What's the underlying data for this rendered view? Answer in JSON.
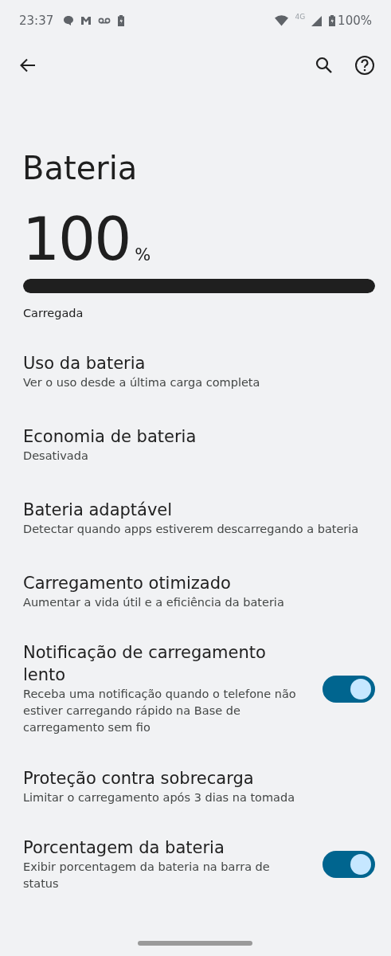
{
  "status_bar": {
    "time": "23:37",
    "network": "4G",
    "battery": "100%"
  },
  "title": "Bateria",
  "battery": {
    "percent": "100",
    "unit": "%",
    "level": 1.0,
    "state": "Carregada"
  },
  "items": [
    {
      "kind": "link",
      "title": "Uso da bateria",
      "summary": "Ver o uso desde a última carga completa"
    },
    {
      "kind": "link",
      "title": "Economia de bateria",
      "summary": "Desativada"
    },
    {
      "kind": "link",
      "title": "Bateria adaptável",
      "summary": "Detectar quando apps estiverem descarregando a bateria"
    },
    {
      "kind": "link",
      "title": "Carregamento otimizado",
      "summary": "Aumentar a vida útil e a eficiência da bateria"
    },
    {
      "kind": "toggle",
      "title": "Notificação de carregamento lento",
      "summary": "Receba uma notificação quando o telefone não estiver carregando rápido na Base de carregamento sem fio",
      "on": true
    },
    {
      "kind": "link",
      "title": "Proteção contra sobrecarga",
      "summary": "Limitar o carregamento após 3 dias na tomada"
    },
    {
      "kind": "toggle",
      "title": "Porcentagem da bateria",
      "summary": "Exibir porcentagem da bateria na barra de status",
      "on": true
    }
  ]
}
